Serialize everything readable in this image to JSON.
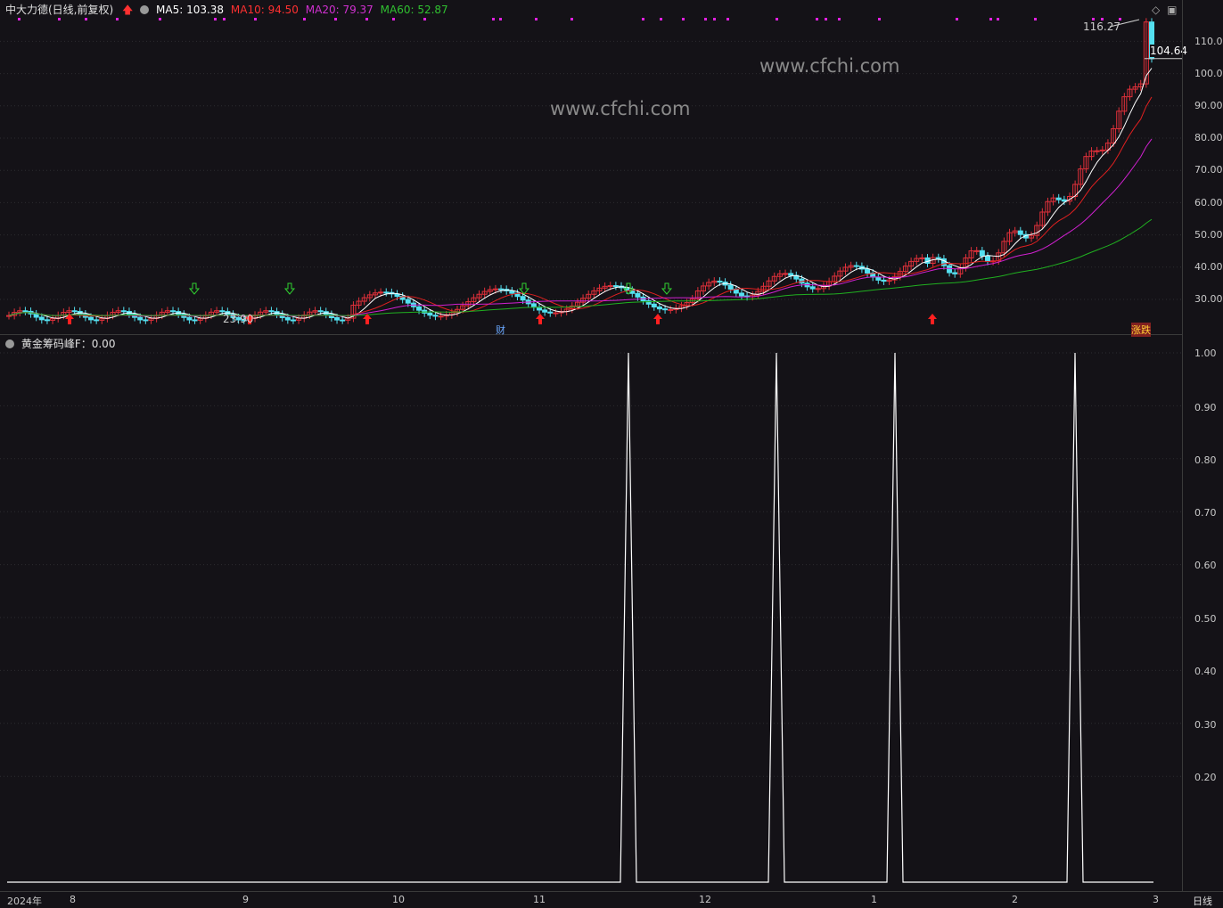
{
  "header": {
    "title": "中大力德(日线,前复权)",
    "ma5": "MA5: 103.38",
    "ma10": "MA10: 94.50",
    "ma20": "MA20: 79.37",
    "ma60": "MA60: 52.87"
  },
  "indicator": {
    "label": "黄金筹码峰F：0.00"
  },
  "watermarks": [
    "www.cfchi.com",
    "www.cfchi.com"
  ],
  "annotations": {
    "high": "116.27",
    "low": "23.90",
    "last_price": "104.64",
    "finance_marker": "财",
    "limit_tag": "涨跌"
  },
  "price_axis": [
    "110.0",
    "100.0",
    "90.00",
    "80.00",
    "70.00",
    "60.00",
    "50.00",
    "40.00",
    "30.00"
  ],
  "indicator_axis": [
    "1.00",
    "0.90",
    "0.80",
    "0.70",
    "0.60",
    "0.50",
    "0.40",
    "0.30",
    "0.20"
  ],
  "x_axis": [
    "2024年",
    "8",
    "9",
    "10",
    "11",
    "12",
    "1",
    "2",
    "3"
  ],
  "period_button": "日线",
  "colors": {
    "ma5": "#ffffff",
    "ma10": "#e02020",
    "ma20": "#d020d0",
    "ma60": "#20b020",
    "up": "#e0303a",
    "down": "#54e0f0",
    "indicator": "#ffffff"
  },
  "chart_data": [
    {
      "type": "line",
      "title": "中大力德(日线,前复权)",
      "ylim": [
        20,
        116.27
      ],
      "series": [
        {
          "name": "MA5",
          "last": 103.38
        },
        {
          "name": "MA10",
          "last": 94.5
        },
        {
          "name": "MA20",
          "last": 79.37
        },
        {
          "name": "MA60",
          "last": 52.87
        }
      ]
    },
    {
      "type": "line",
      "title": "黄金筹码峰F",
      "ylim": [
        0,
        1
      ],
      "series": [
        {
          "name": "黄金筹码峰F",
          "spikes": [
            {
              "date_approx": "2024-11-28",
              "value": 1.0
            },
            {
              "date_approx": "2024-12-23",
              "value": 1.0
            },
            {
              "date_approx": "2025-01-16",
              "value": 1.0
            },
            {
              "date_approx": "2025-02-18",
              "value": 1.0
            }
          ],
          "baseline": 0.0
        }
      ]
    }
  ]
}
